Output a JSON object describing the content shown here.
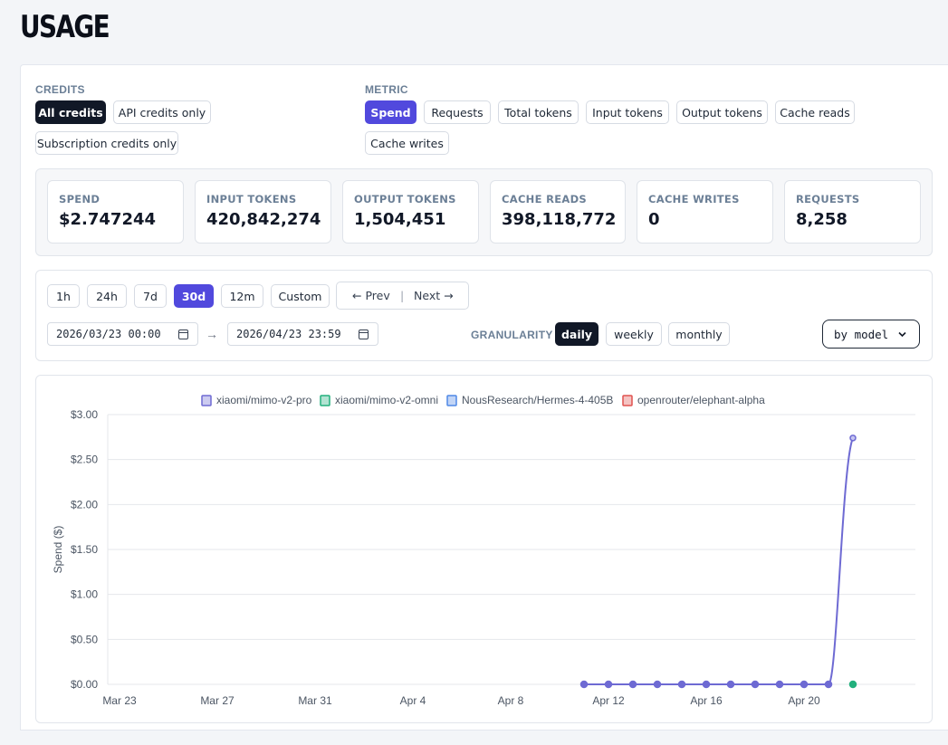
{
  "page": {
    "title": "USAGE"
  },
  "credits": {
    "label": "CREDITS",
    "options": [
      "All credits",
      "API credits only",
      "Subscription credits only"
    ],
    "selected": "All credits"
  },
  "metric": {
    "label": "METRIC",
    "options": [
      "Spend",
      "Requests",
      "Total tokens",
      "Input tokens",
      "Output tokens",
      "Cache reads",
      "Cache writes"
    ],
    "selected": "Spend"
  },
  "stats": [
    {
      "label": "SPEND",
      "value": "$2.747244"
    },
    {
      "label": "INPUT TOKENS",
      "value": "420,842,274"
    },
    {
      "label": "OUTPUT TOKENS",
      "value": "1,504,451"
    },
    {
      "label": "CACHE READS",
      "value": "398,118,772"
    },
    {
      "label": "CACHE WRITES",
      "value": "0"
    },
    {
      "label": "REQUESTS",
      "value": "8,258"
    }
  ],
  "range": {
    "options": [
      "1h",
      "24h",
      "7d",
      "30d",
      "12m",
      "Custom"
    ],
    "selected": "30d",
    "prev": "← Prev",
    "separator": "|",
    "next": "Next →",
    "start": "2026/03/23 00:00",
    "end": "2026/04/23 23:59",
    "arrow": "→"
  },
  "granularity": {
    "label": "GRANULARITY",
    "options": [
      "daily",
      "weekly",
      "monthly"
    ],
    "selected": "daily"
  },
  "group_by": {
    "value": "by model"
  },
  "colors": {
    "accent": "#5149dd",
    "dark": "#111827",
    "mimo_pro": "#6e6ad3",
    "mimo_omni": "#22b07d",
    "hermes": "#4f88e6",
    "elephant": "#e0524f"
  },
  "chart_data": {
    "type": "line",
    "ylabel": "Spend ($)",
    "yticks": [
      "$3.00",
      "$2.50",
      "$2.00",
      "$1.50",
      "$1.00",
      "$0.50",
      "$0.00"
    ],
    "ylim": [
      0,
      3
    ],
    "xticks": [
      "Mar 23",
      "Mar 27",
      "Mar 31",
      "Apr 4",
      "Apr 8",
      "Apr 12",
      "Apr 16",
      "Apr 20"
    ],
    "x": [
      "Mar 23",
      "Mar 24",
      "Mar 25",
      "Mar 26",
      "Mar 27",
      "Mar 28",
      "Mar 29",
      "Mar 30",
      "Mar 31",
      "Apr 1",
      "Apr 2",
      "Apr 3",
      "Apr 4",
      "Apr 5",
      "Apr 6",
      "Apr 7",
      "Apr 8",
      "Apr 9",
      "Apr 10",
      "Apr 11",
      "Apr 12",
      "Apr 13",
      "Apr 14",
      "Apr 15",
      "Apr 16",
      "Apr 17",
      "Apr 18",
      "Apr 19",
      "Apr 20",
      "Apr 21",
      "Apr 22",
      "Apr 23",
      "Apr 24"
    ],
    "legend_position": "top-center",
    "grid": true,
    "series": [
      {
        "name": "xiaomi/mimo-v2-pro",
        "color": "#6e6ad3",
        "start_index": 19,
        "values": [
          0,
          0,
          0,
          0,
          0,
          0,
          0,
          0,
          0,
          0,
          0,
          2.74
        ]
      },
      {
        "name": "xiaomi/mimo-v2-omni",
        "color": "#22b07d",
        "start_index": 30,
        "values": [
          0
        ]
      },
      {
        "name": "NousResearch/Hermes-4-405B",
        "color": "#4f88e6",
        "start_index": 19,
        "values": []
      },
      {
        "name": "openrouter/elephant-alpha",
        "color": "#e0524f",
        "start_index": 19,
        "values": []
      }
    ]
  }
}
